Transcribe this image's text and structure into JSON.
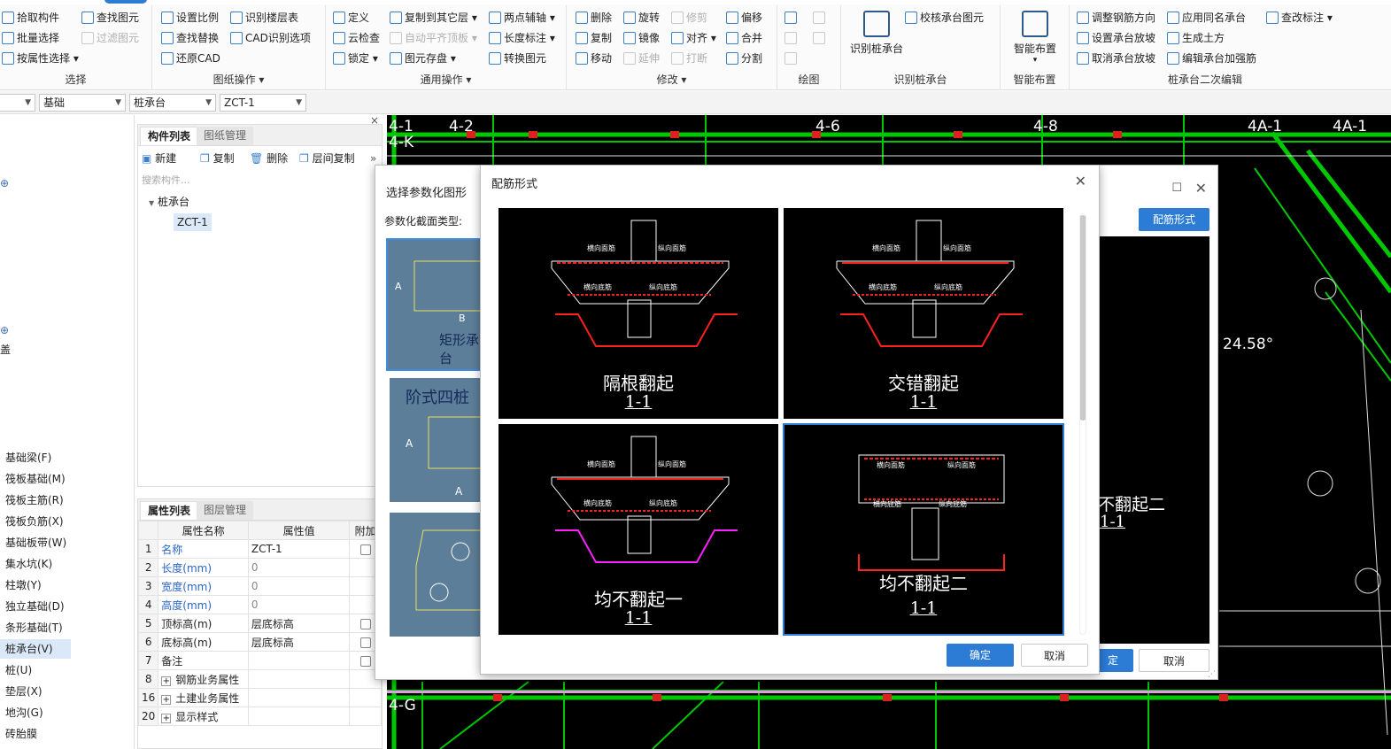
{
  "ribbon": {
    "select": {
      "label": "选择",
      "items": [
        "拾取构件",
        "批量选择",
        "按属性选择",
        "查找图元",
        "过滤图元"
      ]
    },
    "drawing": {
      "label": "图纸操作",
      "items": [
        "设置比例",
        "查找替换",
        "还原CAD",
        "识别楼层表",
        "CAD识别选项"
      ]
    },
    "common": {
      "label": "通用操作",
      "items": [
        "定义",
        "云检查",
        "锁定",
        "复制到其它层",
        "自动平齐顶板",
        "图元存盘",
        "两点辅轴",
        "长度标注",
        "转换图元"
      ]
    },
    "modify": {
      "label": "修改",
      "items": [
        "删除",
        "复制",
        "移动",
        "旋转",
        "镜像",
        "延伸",
        "修剪",
        "对齐",
        "打断",
        "偏移",
        "合并",
        "分割"
      ]
    },
    "draw": {
      "label": "绘图"
    },
    "identify": {
      "label": "识别桩承台",
      "big": "识别桩承台",
      "check": "校核承台图元"
    },
    "smart": {
      "label": "智能布置",
      "big": "智能布置"
    },
    "edit2": {
      "label": "桩承台二次编辑",
      "items": [
        "调整钢筋方向",
        "设置承台放坡",
        "取消承台放坡",
        "应用同名承台",
        "生成土方",
        "编辑承台加强筋",
        "查改标注"
      ]
    }
  },
  "floorbar": {
    "sel1": "",
    "sel2": "基础",
    "sel3": "桩承台",
    "sel4": "ZCT-1"
  },
  "leftnav": {
    "items": [
      "基础梁(F)",
      "筏板基础(M)",
      "筏板主筋(R)",
      "筏板负筋(X)",
      "基础板带(W)",
      "集水坑(K)",
      "柱墩(Y)",
      "独立基础(D)",
      "条形基础(T)",
      "桩承台(V)",
      "桩(U)",
      "垫层(X)",
      "地沟(G)",
      "砖胎膜"
    ],
    "frag": [
      "盖"
    ]
  },
  "comp": {
    "tab1": "构件列表",
    "tab2": "图纸管理",
    "new": "新建",
    "copy": "复制",
    "del": "删除",
    "layercopy": "层间复制",
    "search": "搜索构件...",
    "tree_root": "桩承台",
    "tree_item": "ZCT-1"
  },
  "prop": {
    "tab1": "属性列表",
    "tab2": "图层管理",
    "headers": [
      "属性名称",
      "属性值",
      "附加"
    ],
    "rows": [
      {
        "no": "1",
        "name": "名称",
        "val": "ZCT-1",
        "blue": true,
        "cb": false
      },
      {
        "no": "2",
        "name": "长度(mm)",
        "val": "0",
        "blue": true,
        "cb": false
      },
      {
        "no": "3",
        "name": "宽度(mm)",
        "val": "0",
        "blue": true,
        "cb": false
      },
      {
        "no": "4",
        "name": "高度(mm)",
        "val": "0",
        "blue": true,
        "cb": false
      },
      {
        "no": "5",
        "name": "顶标高(m)",
        "val": "层底标高",
        "blue": false,
        "cb": true
      },
      {
        "no": "6",
        "name": "底标高(m)",
        "val": "层底标高",
        "blue": false,
        "cb": true
      },
      {
        "no": "7",
        "name": "备注",
        "val": "",
        "blue": false,
        "cb": true
      },
      {
        "no": "8",
        "name": "钢筋业务属性",
        "val": "",
        "blue": false,
        "cb": false,
        "plus": true
      },
      {
        "no": "16",
        "name": "土建业务属性",
        "val": "",
        "blue": false,
        "cb": false,
        "plus": true
      },
      {
        "no": "20",
        "name": "显示样式",
        "val": "",
        "blue": false,
        "cb": false,
        "plus": true
      }
    ]
  },
  "cad": {
    "axes": [
      "4-1",
      "4-2",
      "4-6",
      "4-8",
      "4A-1",
      "4A-1",
      "4-G",
      "4-K"
    ],
    "angle": "24.58°"
  },
  "dlg1": {
    "title": "选择参数化图形",
    "type_label": "参数化截面类型:",
    "shape1": "矩形承台",
    "shape2": "阶式四桩",
    "btn_rebar": "配筋形式",
    "ok": "定",
    "cancel": "取消",
    "bg_caption": "不翻起二",
    "bg_sub": "1-1"
  },
  "dlg2": {
    "title": "配筋形式",
    "ok": "确定",
    "cancel": "取消",
    "tiles": [
      {
        "caption": "隔根翻起",
        "sub": "1-1"
      },
      {
        "caption": "交错翻起",
        "sub": "1-1"
      },
      {
        "caption": "均不翻起一",
        "sub": "1-1"
      },
      {
        "caption": "均不翻起二",
        "sub": "1-1"
      }
    ],
    "labels": {
      "hmj": "横向面筋",
      "zmj": "纵向面筋",
      "hdj": "横向底筋",
      "zdj": "纵向底筋"
    }
  }
}
